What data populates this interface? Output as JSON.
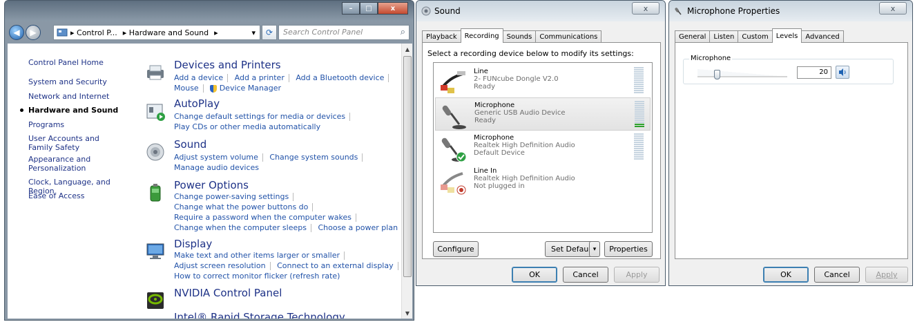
{
  "control_panel": {
    "caption_min": "–",
    "caption_max": "□",
    "caption_close": "x",
    "back_glyph": "◀",
    "forward_glyph": "▶",
    "breadcrumb": [
      "▸ Control P...",
      "▸ Hardware and Sound",
      "▸"
    ],
    "addr_dropdown": "▾",
    "refresh_glyph": "⟳",
    "search_placeholder": "Search Control Panel",
    "search_icon_glyph": "⌕",
    "scroll_up": "▲",
    "scroll_down": "▼",
    "left_nav": [
      "Control Panel Home",
      "System and Security",
      "Network and Internet",
      "Hardware and Sound",
      "Programs",
      "User Accounts and Family Safety",
      "Appearance and Personalization",
      "Clock, Language, and Region",
      "Ease of Access"
    ],
    "categories": [
      {
        "title": "Devices and Printers",
        "lines": [
          [
            "Add a device",
            "Add a printer",
            "Add a Bluetooth device"
          ],
          [
            "Mouse",
            "Device Manager"
          ]
        ]
      },
      {
        "title": "AutoPlay",
        "lines": [
          [
            "Change default settings for media or devices"
          ],
          [
            "Play CDs or other media automatically"
          ]
        ]
      },
      {
        "title": "Sound",
        "lines": [
          [
            "Adjust system volume",
            "Change system sounds"
          ],
          [
            "Manage audio devices"
          ]
        ]
      },
      {
        "title": "Power Options",
        "lines": [
          [
            "Change power-saving settings"
          ],
          [
            "Change what the power buttons do"
          ],
          [
            "Require a password when the computer wakes"
          ],
          [
            "Change when the computer sleeps",
            "Choose a power plan"
          ]
        ]
      },
      {
        "title": "Display",
        "lines": [
          [
            "Make text and other items larger or smaller"
          ],
          [
            "Adjust screen resolution",
            "Connect to an external display"
          ],
          [
            "How to correct monitor flicker (refresh rate)"
          ]
        ]
      },
      {
        "title": "NVIDIA Control Panel",
        "lines": []
      },
      {
        "title": "Intel® Rapid Storage Technology",
        "lines": []
      }
    ]
  },
  "sound_dialog": {
    "title": "Sound",
    "close": "x",
    "tabs": [
      "Playback",
      "Recording",
      "Sounds",
      "Communications"
    ],
    "instruction": "Select a recording device below to modify its settings:",
    "devices": [
      {
        "name": "Line",
        "desc": "2- FUNcube Dongle V2.0",
        "status": "Ready",
        "level": 0
      },
      {
        "name": "Microphone",
        "desc": "Generic USB Audio Device",
        "status": "Ready",
        "level": 2
      },
      {
        "name": "Microphone",
        "desc": "Realtek High Definition Audio",
        "status": "Default Device",
        "level": 0
      },
      {
        "name": "Line In",
        "desc": "Realtek High Definition Audio",
        "status": "Not plugged in",
        "level": 0
      }
    ],
    "configure": "Configure",
    "set_default": "Set Default",
    "set_default_arrow": "▾",
    "properties": "Properties",
    "ok": "OK",
    "cancel": "Cancel",
    "apply": "Apply"
  },
  "mic_dialog": {
    "title": "Microphone Properties",
    "close": "x",
    "tabs": [
      "General",
      "Listen",
      "Custom",
      "Levels",
      "Advanced"
    ],
    "group_label": "Microphone",
    "level": 20,
    "level_text": "20",
    "ok": "OK",
    "cancel": "Cancel",
    "apply": "Apply"
  },
  "colors": {
    "link": "#2152a8",
    "heading": "#1e3287",
    "meter_on": "#2da12d"
  }
}
